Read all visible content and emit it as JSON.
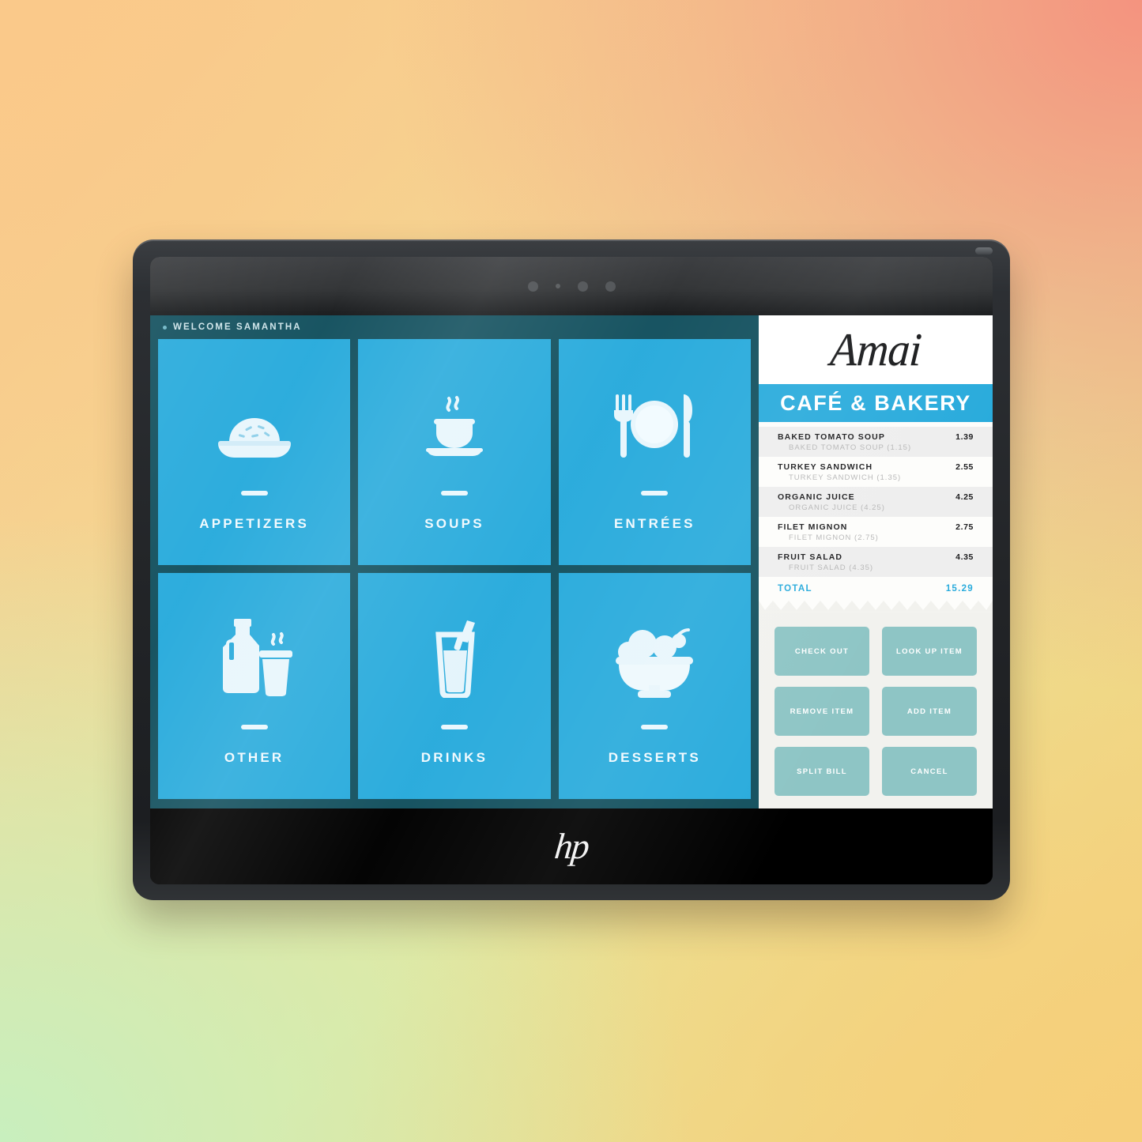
{
  "device": {
    "brand_logo": "hp",
    "sensor_count": 4
  },
  "header": {
    "welcome_text": "WELCOME SAMANTHA"
  },
  "categories": [
    {
      "label": "APPETIZERS",
      "icon": "plate-of-food-icon"
    },
    {
      "label": "SOUPS",
      "icon": "soup-cup-icon"
    },
    {
      "label": "ENTRÉES",
      "icon": "fork-plate-knife-icon"
    },
    {
      "label": "OTHER",
      "icon": "milk-jug-and-coffee-cup-icon"
    },
    {
      "label": "DRINKS",
      "icon": "glass-with-straw-icon"
    },
    {
      "label": "DESSERTS",
      "icon": "ice-cream-sundae-icon"
    }
  ],
  "receipt": {
    "logo_script": "Amai",
    "logo_bar": "CAFÉ & BAKERY",
    "items": [
      {
        "name": "BAKED TOMATO SOUP",
        "price": "1.39",
        "sub": "BAKED TOMATO SOUP (1.15)"
      },
      {
        "name": "TURKEY SANDWICH",
        "price": "2.55",
        "sub": "TURKEY SANDWICH (1.35)"
      },
      {
        "name": "ORGANIC JUICE",
        "price": "4.25",
        "sub": "ORGANIC JUICE (4.25)"
      },
      {
        "name": "FILET MIGNON",
        "price": "2.75",
        "sub": "FILET MIGNON (2.75)"
      },
      {
        "name": "FRUIT SALAD",
        "price": "4.35",
        "sub": "FRUIT SALAD (4.35)"
      }
    ],
    "total_label": "TOTAL",
    "total_value": "15.29",
    "buttons": [
      "CHECK OUT",
      "LOOK UP ITEM",
      "REMOVE ITEM",
      "ADD ITEM",
      "SPLIT BILL",
      "CANCEL"
    ]
  },
  "colors": {
    "tile_blue": "#29abdc",
    "screen_dark_teal": "#14515f",
    "button_teal": "#8ec5c5",
    "receipt_paper": "#fdfdfb",
    "accent_total": "#29abdc"
  }
}
